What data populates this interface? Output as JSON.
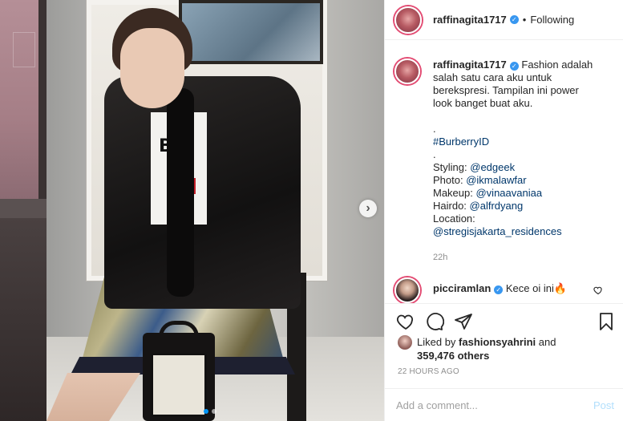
{
  "post": {
    "username": "raffinagita1717",
    "follow_separator": "•",
    "follow_status": "Following",
    "caption_lines": [
      "Fashion adalah",
      "salah satu cara aku untuk",
      "berekspresi. Tampilan ini power",
      "look banget buat aku."
    ],
    "dot1": ".",
    "hashtag": "#BurberryID",
    "dot2": ".",
    "credits": [
      {
        "label": "Styling: ",
        "handle": "@edgeek"
      },
      {
        "label": "Photo: ",
        "handle": "@ikmalawfar"
      },
      {
        "label": "Makeup: ",
        "handle": "@vinaavaniaa"
      },
      {
        "label": "Hairdo: ",
        "handle": "@alfrdyang"
      }
    ],
    "location_label": "Location:",
    "location_handle": "@stregisjakarta_residences",
    "time": "22h",
    "carousel": {
      "slides": 2,
      "active": 1
    }
  },
  "comment": {
    "username": "picciramlan",
    "text": "Kece oi ini🔥"
  },
  "likes": {
    "prefix": "Liked by ",
    "user": "fashionsyahrini",
    "and": " and",
    "count": "359,476 others"
  },
  "timestamp": "22 HOURS AGO",
  "comment_box": {
    "placeholder": "Add a comment...",
    "post_label": "Post"
  },
  "colors": {
    "link": "#00376b",
    "verified": "#3897f0",
    "story_ring": "#e34c73",
    "post_disabled": "#b2dffc"
  },
  "icons": [
    "verified-badge-icon",
    "heart-icon",
    "comment-icon",
    "share-icon",
    "bookmark-icon",
    "chevron-right-icon",
    "small-heart-icon"
  ]
}
